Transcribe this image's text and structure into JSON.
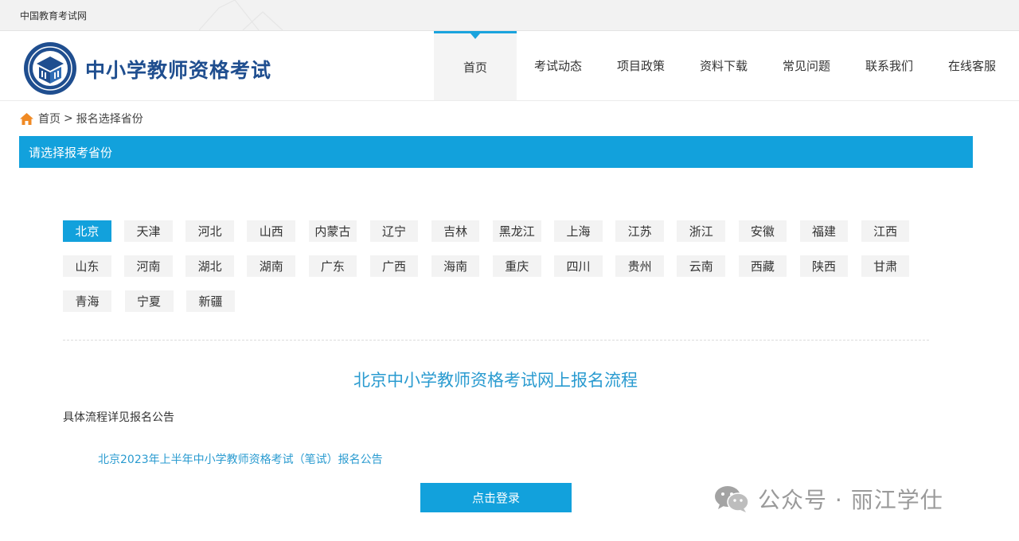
{
  "topbar": {
    "site_name": "中国教育考试网"
  },
  "header": {
    "title": "中小学教师资格考试",
    "nav": [
      "首页",
      "考试动态",
      "项目政策",
      "资料下载",
      "常见问题",
      "联系我们",
      "在线客服"
    ],
    "active_nav": "首页"
  },
  "breadcrumb": {
    "home": "首页",
    "separator": ">",
    "current": "报名选择省份"
  },
  "section": {
    "title": "请选择报考省份"
  },
  "provinces": {
    "rows": [
      [
        "北京",
        "天津",
        "河北",
        "山西",
        "内蒙古",
        "辽宁",
        "吉林",
        "黑龙江",
        "上海",
        "江苏",
        "浙江",
        "安徽",
        "福建",
        "江西"
      ],
      [
        "山东",
        "河南",
        "湖北",
        "湖南",
        "广东",
        "广西",
        "海南",
        "重庆",
        "四川",
        "贵州",
        "云南",
        "西藏",
        "陕西",
        "甘肃"
      ],
      [
        "青海",
        "宁夏",
        "新疆"
      ]
    ],
    "selected": "北京"
  },
  "content": {
    "flow_title": "北京中小学教师资格考试网上报名流程",
    "detail": "具体流程详见报名公告",
    "notice_link": "北京2023年上半年中小学教师资格考试（笔试）报名公告",
    "login_button": "点击登录"
  },
  "watermark": {
    "text": "公众号 · 丽江学仕"
  },
  "colors": {
    "primary": "#12a1dc",
    "title_blue": "#1f4e8f",
    "link_blue": "#2a9bd0"
  }
}
